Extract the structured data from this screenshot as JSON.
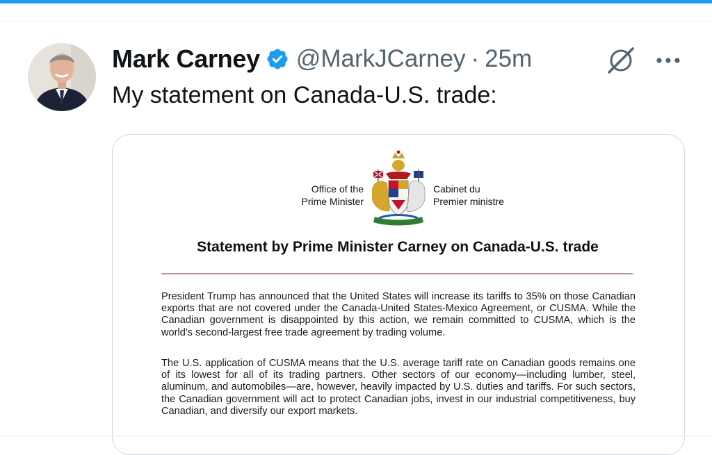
{
  "tweet": {
    "author": {
      "display_name": "Mark Carney",
      "handle": "@MarkJCarney",
      "verified": true
    },
    "separator": "·",
    "timestamp": "25m",
    "text": "My statement on Canada-U.S. trade:"
  },
  "actions": {
    "grok_icon": "grok-icon",
    "more_icon": "more-icon"
  },
  "document": {
    "office_en_line1": "Office of the",
    "office_en_line2": "Prime Minister",
    "office_fr_line1": "Cabinet du",
    "office_fr_line2": "Premier ministre",
    "title": "Statement by Prime Minister Carney on Canada-U.S. trade",
    "paragraphs": [
      "President Trump has announced that the United States will increase its tariffs to 35% on those Canadian exports that are not covered under the Canada-United States-Mexico Agreement, or CUSMA. While the Canadian government is disappointed by this action, we remain committed to CUSMA, which is the world's second-largest free trade agreement by trading volume.",
      "The U.S. application of CUSMA means that the U.S. average tariff rate on Canadian goods remains one of its lowest for all of its trading partners. Other sectors of our economy—including lumber, steel, aluminum, and automobiles—are, however, heavily impacted by U.S. duties and tariffs. For such sectors, the Canadian government will act to protect Canadian jobs, invest in our industrial competitiveness, buy Canadian, and diversify our export markets."
    ]
  },
  "colors": {
    "accent": "#1d9bf0",
    "text_primary": "#0f1419",
    "text_secondary": "#536471",
    "card_border": "#cfd9de"
  }
}
